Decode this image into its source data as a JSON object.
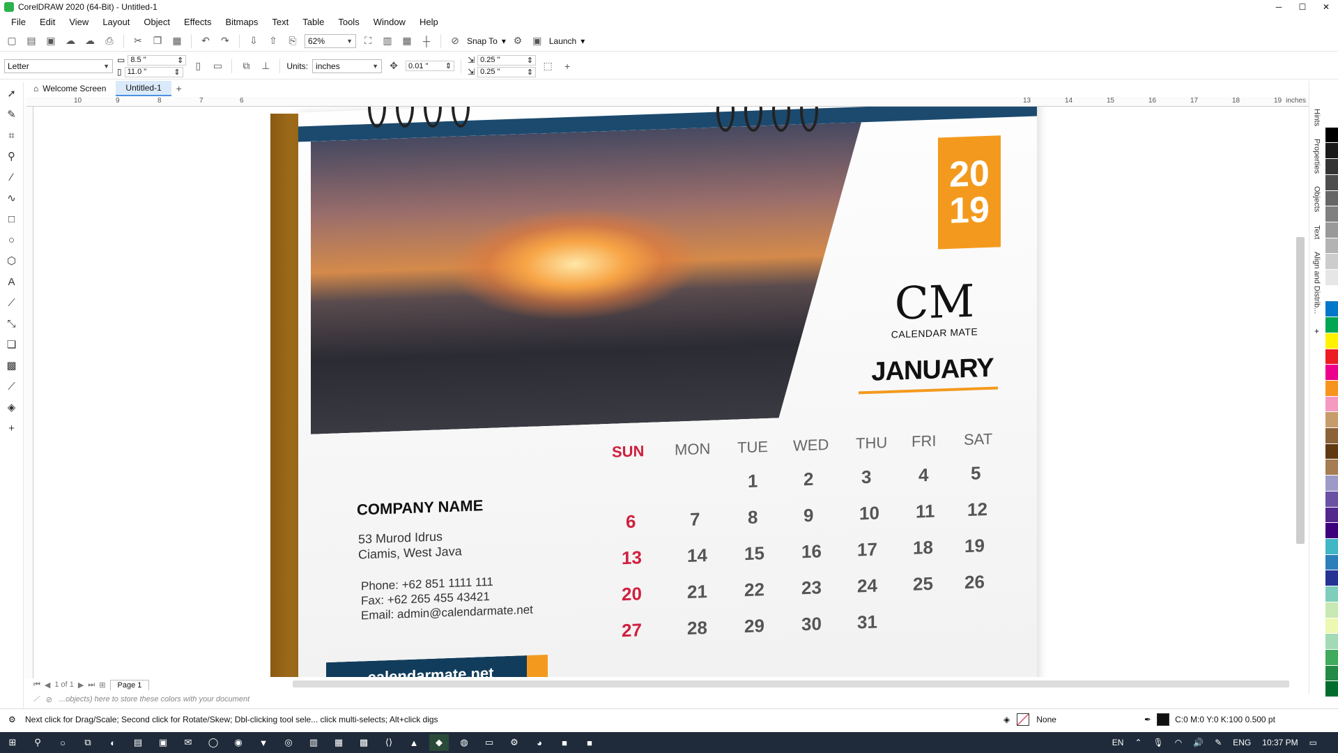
{
  "window": {
    "title": "CorelDRAW 2020 (64-Bit) - Untitled-1",
    "controls": [
      "─",
      "☐",
      "✕"
    ]
  },
  "menu": [
    "File",
    "Edit",
    "View",
    "Layout",
    "Object",
    "Effects",
    "Bitmaps",
    "Text",
    "Table",
    "Tools",
    "Window",
    "Help"
  ],
  "toolbar": {
    "zoom": "62%",
    "snap_to": "Snap To",
    "launch": "Launch"
  },
  "property_bar": {
    "page_size": "Letter",
    "width": "8.5 \"",
    "height": "11.0 \"",
    "units_label": "Units:",
    "units": "inches",
    "nudge": "0.01 \"",
    "dup_x": "0.25 \"",
    "dup_y": "0.25 \""
  },
  "tabs": [
    {
      "label": "Welcome Screen"
    },
    {
      "label": "Untitled-1"
    }
  ],
  "ruler": {
    "labels": [
      "10",
      "9",
      "8",
      "7",
      "6",
      "13",
      "14",
      "15",
      "16",
      "17",
      "18",
      "19"
    ],
    "unit": "inches"
  },
  "dockers": [
    "Hints",
    "Properties",
    "Objects",
    "Text",
    "Align and Distrib..."
  ],
  "page_nav": {
    "counter": "1 of 1",
    "page": "Page 1"
  },
  "doc_palette_hint": "...objects) here to store these colors with your document",
  "status": {
    "hint": "Next click for Drag/Scale; Second click for Rotate/Skew; Dbl-clicking tool sele... click multi-selects; Alt+click digs",
    "fill": "None",
    "outline": "C:0 M:0 Y:0 K:100  0.500 pt"
  },
  "taskbar": {
    "lang1": "EN",
    "lang2": "ENG",
    "time": "10:37 PM"
  },
  "calendar": {
    "year_top": "20",
    "year_bottom": "19",
    "logo_mark": "CM",
    "logo_text": "CALENDAR MATE",
    "month": "JANUARY",
    "days": [
      "SUN",
      "MON",
      "TUE",
      "WED",
      "THU",
      "FRI",
      "SAT"
    ],
    "weeks": [
      [
        "",
        "",
        "1",
        "2",
        "3",
        "4",
        "5"
      ],
      [
        "6",
        "7",
        "8",
        "9",
        "10",
        "11",
        "12"
      ],
      [
        "13",
        "14",
        "15",
        "16",
        "17",
        "18",
        "19"
      ],
      [
        "20",
        "21",
        "22",
        "23",
        "24",
        "25",
        "26"
      ],
      [
        "27",
        "28",
        "29",
        "30",
        "31",
        "",
        ""
      ]
    ],
    "company": "COMPANY NAME",
    "address_1": "53 Murod Idrus",
    "address_2": "Ciamis, West Java",
    "phone": "Phone: +62 851 1111 111",
    "fax": "Fax: +62 265 455 43421",
    "email": "Email: admin@calendarmate.net",
    "website": "calendarmate.net",
    "colors": {
      "accent": "#f39a1e",
      "navy": "#1c4a6e",
      "sunday": "#d0203f"
    }
  },
  "palette_colors": [
    "#ffffff",
    "#000000",
    "#1a1a1a",
    "#333333",
    "#4d4d4d",
    "#666666",
    "#808080",
    "#999999",
    "#b3b3b3",
    "#cccccc",
    "#e6e6e6",
    "#ffffff",
    "#0077c8",
    "#00a651",
    "#fff200",
    "#ed1c24",
    "#ec008c",
    "#f7941d",
    "#f49ac1",
    "#c69c6d",
    "#8c6239",
    "#603913",
    "#a67c52",
    "#9e9ac8",
    "#6a51a3",
    "#54278f",
    "#3f007d",
    "#41b6c4",
    "#2c7fb8",
    "#253494",
    "#7fcdbb",
    "#c7e9b4",
    "#edf8b1",
    "#a1dab4",
    "#41ab5d",
    "#238b45",
    "#006d2c"
  ]
}
